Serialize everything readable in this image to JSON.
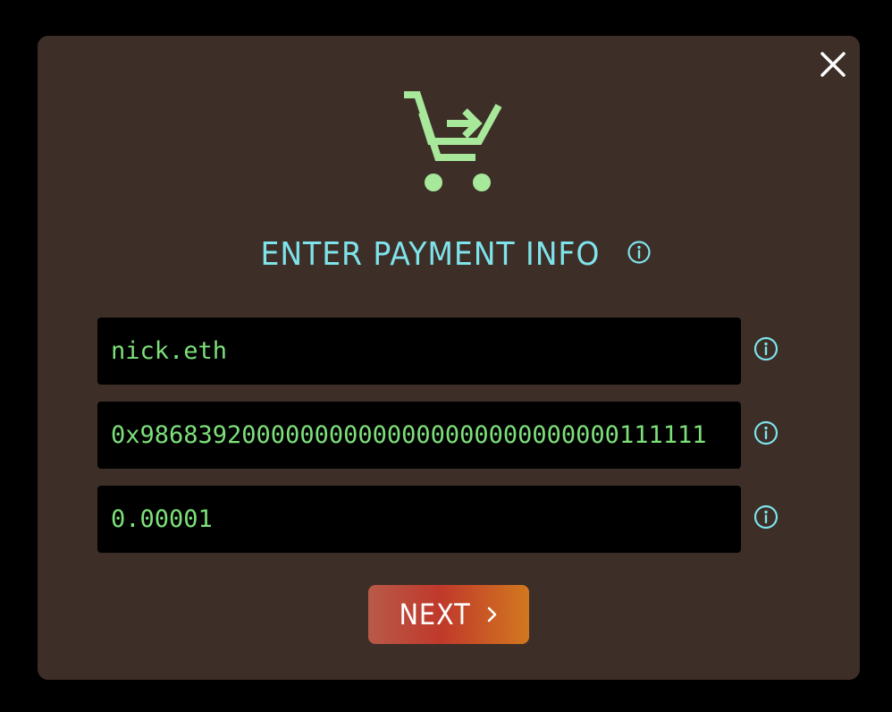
{
  "dialog": {
    "title": "ENTER PAYMENT INFO",
    "close_icon": "close-icon",
    "hero_icon": "cart-arrow-icon",
    "info_icon": "info-icon"
  },
  "fields": [
    {
      "name": "recipient",
      "value": "nick.eth"
    },
    {
      "name": "address",
      "value": "0x986839200000000000000000000000000111111"
    },
    {
      "name": "amount",
      "value": "0.00001"
    }
  ],
  "next_button": {
    "label": "NEXT",
    "icon": "chevron-right-icon"
  },
  "colors": {
    "background": "#000000",
    "panel": "#3d2e28",
    "accent_cyan": "#7ee3ea",
    "accent_green": "#a8e89a",
    "input_text": "#7de07a",
    "button_gradient_start": "#b85a48",
    "button_gradient_mid": "#c0392b",
    "button_gradient_end": "#d2781f"
  }
}
